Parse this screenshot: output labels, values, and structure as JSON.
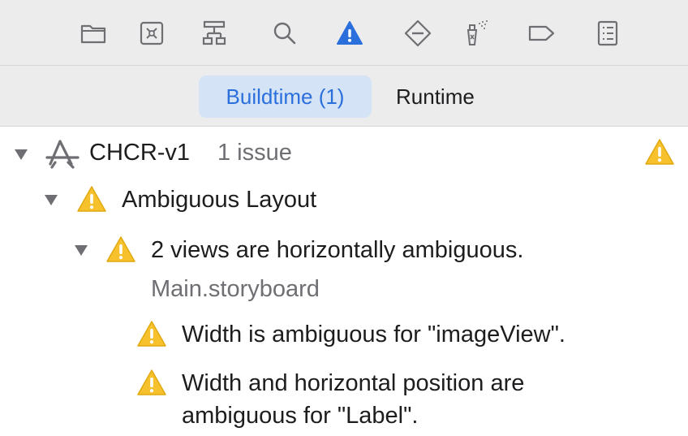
{
  "toolbar": {
    "icons": [
      "folder-icon",
      "source-control-icon",
      "hierarchy-icon",
      "search-icon",
      "issue-warning-icon",
      "test-diamond-icon",
      "debug-spray-icon",
      "breakpoint-tag-icon",
      "report-list-icon"
    ],
    "active_icon": "issue-warning-icon"
  },
  "scope": {
    "buildtime_label": "Buildtime (1)",
    "runtime_label": "Runtime"
  },
  "tree": {
    "project": {
      "name": "CHCR-v1",
      "count": "1 issue"
    },
    "group": {
      "label": "Ambiguous Layout"
    },
    "issue": {
      "label": "2 views are horizontally ambiguous.",
      "file": "Main.storyboard"
    },
    "children": [
      {
        "line1": "Width is ambiguous for \"imageView\".",
        "line2": ""
      },
      {
        "line1": "Width and horizontal position are",
        "line2": "ambiguous for \"Label\"."
      }
    ]
  },
  "colors": {
    "accent": "#2a6fdb",
    "warning": "#f6c12d",
    "toolbar_bg": "#ececec"
  }
}
